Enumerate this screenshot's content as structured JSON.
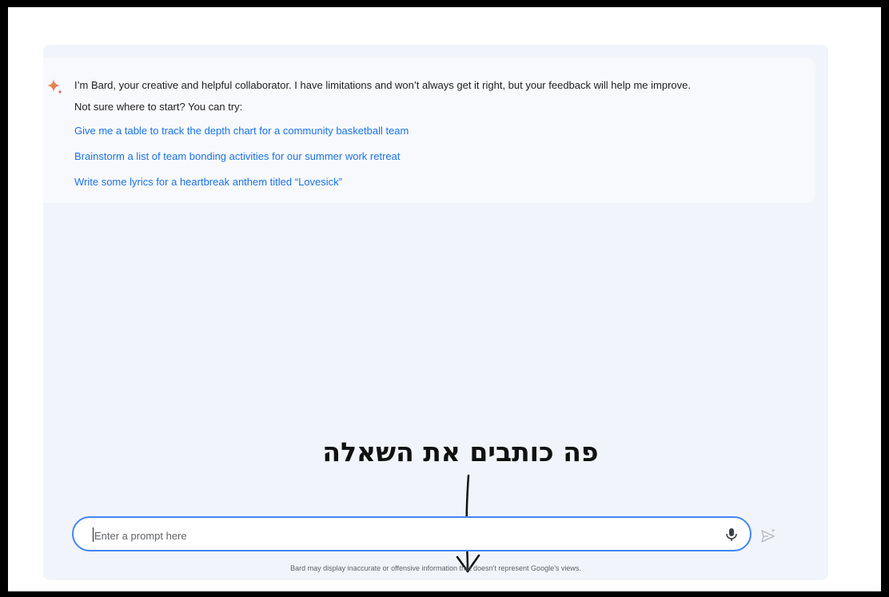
{
  "welcome": {
    "intro": "I’m Bard, your creative and helpful collaborator. I have limitations and won’t always get it right, but your feedback will help me improve.",
    "try_label": "Not sure where to start? You can try:",
    "suggestions": [
      "Give me a table to track the depth chart for a community basketball team",
      "Brainstorm a list of team bonding activities for our summer work retreat",
      "Write some lyrics for a heartbreak anthem titled “Lovesick”"
    ]
  },
  "annotation": {
    "text": "פה כותבים את השאלה"
  },
  "prompt": {
    "placeholder": "Enter a prompt here",
    "value": ""
  },
  "disclaimer": "Bard may display inaccurate or offensive information that doesn’t represent Google’s views.",
  "icons": {
    "logo": "bard-sparkle-icon",
    "mic": "microphone-icon",
    "send": "send-icon",
    "arrow": "annotation-arrow-down"
  },
  "colors": {
    "link": "#1a73e8",
    "prompt_border": "#4285f4",
    "chat_bg": "#f1f4fb",
    "card_bg": "#f8f9fc"
  }
}
